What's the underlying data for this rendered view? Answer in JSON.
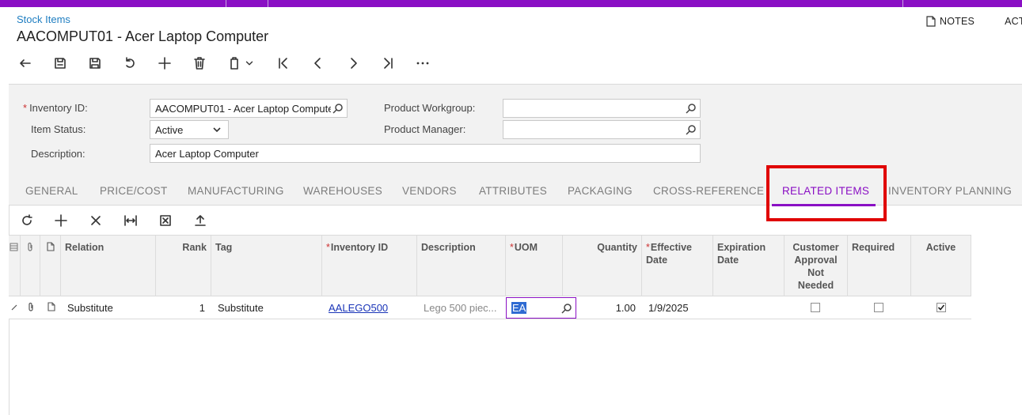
{
  "breadcrumb": "Stock Items",
  "page_title": "AACOMPUT01 - Acer Laptop Computer",
  "top_links": {
    "notes": "NOTES",
    "activities": "ACTIV"
  },
  "toolbar_icons": [
    "undo-icon",
    "save-close-icon",
    "save-icon",
    "cancel-icon",
    "add-icon",
    "delete-icon",
    "copy-paste-icon",
    "first-record-icon",
    "previous-record-icon",
    "next-record-icon",
    "last-record-icon",
    "more-icon"
  ],
  "form": {
    "inventory_id": {
      "label": "Inventory ID:",
      "value": "AACOMPUT01 - Acer Laptop Computer"
    },
    "item_status": {
      "label": "Item Status:",
      "value": "Active"
    },
    "description": {
      "label": "Description:",
      "value": "Acer Laptop Computer"
    },
    "product_workgroup": {
      "label": "Product Workgroup:",
      "value": ""
    },
    "product_manager": {
      "label": "Product Manager:",
      "value": ""
    }
  },
  "tabs": [
    {
      "label": "GENERAL"
    },
    {
      "label": "PRICE/COST"
    },
    {
      "label": "MANUFACTURING"
    },
    {
      "label": "WAREHOUSES"
    },
    {
      "label": "VENDORS"
    },
    {
      "label": "ATTRIBUTES"
    },
    {
      "label": "PACKAGING"
    },
    {
      "label": "CROSS-REFERENCE"
    },
    {
      "label": "RELATED ITEMS",
      "active": true
    },
    {
      "label": "INVENTORY PLANNING"
    }
  ],
  "accent_color": "#8a0fc4",
  "highlight_color": "#e00000",
  "grid": {
    "columns": [
      {
        "label": "Relation"
      },
      {
        "label": "Rank"
      },
      {
        "label": "Tag"
      },
      {
        "label": "Inventory ID",
        "required": true
      },
      {
        "label": "Description"
      },
      {
        "label": "UOM",
        "required": true
      },
      {
        "label": "Quantity"
      },
      {
        "label": "Effective Date",
        "required": true
      },
      {
        "label": "Expiration Date"
      },
      {
        "label": "Customer Approval Not Needed"
      },
      {
        "label": "Required"
      },
      {
        "label": "Active"
      }
    ],
    "rows": [
      {
        "relation": "Substitute",
        "rank": "1",
        "tag": "Substitute",
        "inventory_id": "AALEGO500",
        "description": "Lego 500 piec...",
        "uom": "EA",
        "quantity": "1.00",
        "effective_date": "1/9/2025",
        "expiration_date": "",
        "customer_approval_not_needed": false,
        "required": false,
        "active": true
      }
    ]
  }
}
